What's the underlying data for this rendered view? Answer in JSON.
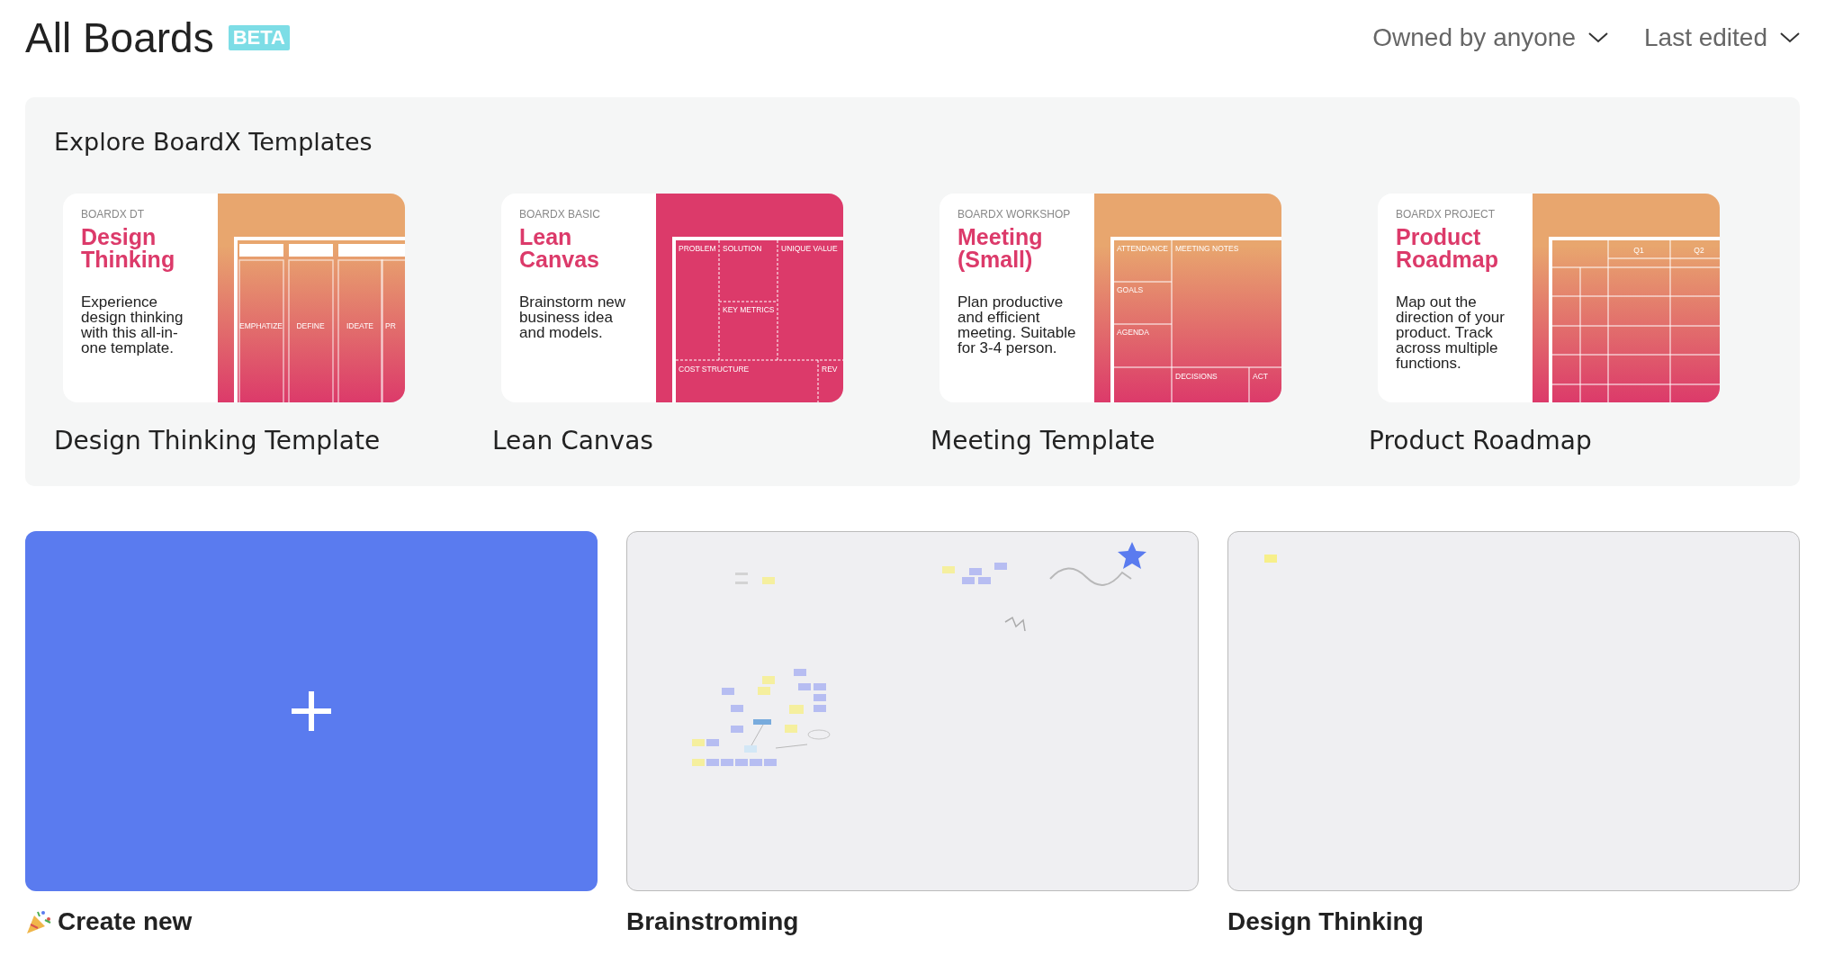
{
  "header": {
    "title": "All Boards",
    "badge": "BETA",
    "filters": [
      {
        "label": "Owned by anyone"
      },
      {
        "label": "Last edited"
      }
    ]
  },
  "templates": {
    "heading": "Explore BoardX Templates",
    "items": [
      {
        "category": "BOARDX DT",
        "title": "Design Thinking",
        "description": "Experience design thinking with this all-in-one template.",
        "kind": "columns",
        "grid_labels": [
          "EMPHATIZE",
          "DEFINE",
          "IDEATE",
          "PR"
        ],
        "name": "Design Thinking Template"
      },
      {
        "category": "BOARDX BASIC",
        "title": "Lean Canvas",
        "description": "Brainstorm new business idea and models.",
        "kind": "lean",
        "grid_labels": [
          "PROBLEM",
          "SOLUTION",
          "UNIQUE VALUE",
          "KEY METRICS",
          "COST STRUCTURE",
          "REV"
        ],
        "name": "Lean Canvas"
      },
      {
        "category": "BOARDX WORKSHOP",
        "title": "Meeting (Small)",
        "description": "Plan productive and efficient meeting. Suitable for 3-4 person.",
        "kind": "meeting",
        "grid_labels": [
          "ATTENDANCE",
          "MEETING NOTES",
          "GOALS",
          "AGENDA",
          "DECISIONS",
          "ACT"
        ],
        "name": "Meeting Template"
      },
      {
        "category": "BOARDX PROJECT",
        "title": "Product Roadmap",
        "description": "Map out the direction of your product. Track across multiple functions.",
        "kind": "roadmap",
        "grid_labels": [
          "Q1",
          "Q2"
        ],
        "name": "Product Roadmap"
      }
    ]
  },
  "create": {
    "label": "Create new"
  },
  "boards": [
    {
      "name": "Brainstroming",
      "starred": true,
      "kind": "mindmap"
    },
    {
      "name": "Design Thinking",
      "starred": false,
      "kind": "note"
    }
  ]
}
